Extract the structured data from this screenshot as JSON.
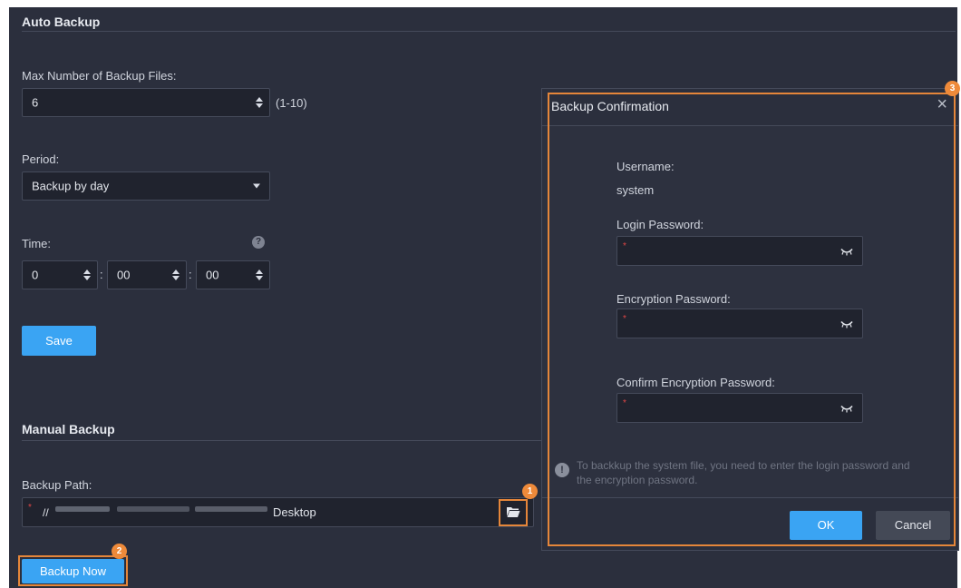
{
  "auto_backup": {
    "title": "Auto Backup",
    "max_files_label": "Max Number of Backup Files:",
    "max_files_value": "6",
    "max_files_range": "(1-10)",
    "period_label": "Period:",
    "period_value": "Backup by day",
    "time_label": "Time:",
    "time_hour": "0",
    "time_minute": "00",
    "time_second": "00",
    "time_separator": ":",
    "save_label": "Save"
  },
  "manual_backup": {
    "title": "Manual Backup",
    "path_label": "Backup Path:",
    "path_prefix": "//",
    "path_suffix": "Desktop",
    "required_mark": "*",
    "backup_now_label": "Backup Now"
  },
  "dialog": {
    "title": "Backup Confirmation",
    "close_glyph": "×",
    "username_label": "Username:",
    "username_value": "system",
    "login_password_label": "Login Password:",
    "encryption_password_label": "Encryption Password:",
    "confirm_encryption_password_label": "Confirm Encryption Password:",
    "required_mark": "*",
    "notice": "To backkup the system file, you need to enter the login password and the encryption password.",
    "notice_icon": "!",
    "ok_label": "OK",
    "cancel_label": "Cancel"
  },
  "callouts": {
    "badge_1": "1",
    "badge_2": "2",
    "badge_3": "3"
  },
  "colors": {
    "background": "#2b2f3d",
    "accent": "#3aa4f3",
    "callout": "#e5863a",
    "required": "#e04646"
  },
  "icons": {
    "spin": "up-down-arrows-icon",
    "dropdown": "caret-down-icon",
    "help": "question-circle-icon",
    "folder": "folder-open-icon",
    "eye": "eye-closed-icon",
    "close": "close-icon",
    "info": "exclamation-circle-icon"
  }
}
